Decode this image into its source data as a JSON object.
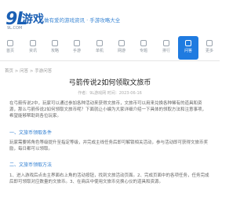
{
  "brand": {
    "logo_mark": "9L",
    "logo_name": "游戏",
    "logo_sub": "9L.COM",
    "tagline": "做有爱的游戏资讯 · 手游攻略大全"
  },
  "nav": {
    "items": [
      {
        "label": "首页"
      },
      {
        "label": "资讯"
      },
      {
        "label": "攻略"
      },
      {
        "label": "手游"
      },
      {
        "label": "单机"
      },
      {
        "label": "网游"
      },
      {
        "label": "专题"
      },
      {
        "label": "排行"
      },
      {
        "label": "问答"
      },
      {
        "label": "更多"
      }
    ],
    "active_index": 8
  },
  "breadcrumb": "首页 > 问答 > 手游问答",
  "article": {
    "title": "弓箭传说2如何领取文旅币",
    "meta": "作者：9L游戏网 时间：2023-06-16",
    "intro": "在弓箭传说2中，玩家可以通过参加各种活动来获得文旅币，文旅币可以用来兑换各种稀有的道具和资源，那么弓箭传说2如何领取文旅币呢？下面就让小编为大家详细介绍一下具体的领取方法和注意事项，希望能够帮助到各位玩家。",
    "section1_title": "一、文旅币领取条件",
    "section1_text": "玩家需要将角色等级提升至指定等级，并完成主线任务后即可解锁相关活动，参与活动即可获得文旅币奖励，每日都可以领取。",
    "section2_title": "二、文旅币领取方法",
    "section2_text": "1、进入游戏后点击主界面右上角的活动按钮，找到文旅活动页面。2、完成页面中的各项任务，任务完成后即可领取对应数量的文旅币。3、在商店中使用文旅币兑换心仪的道具和资源。"
  },
  "colors": {
    "brand_blue": "#1a5fb4",
    "active_nav": "#1f7be0",
    "section_blue": "#2a7bd0"
  }
}
